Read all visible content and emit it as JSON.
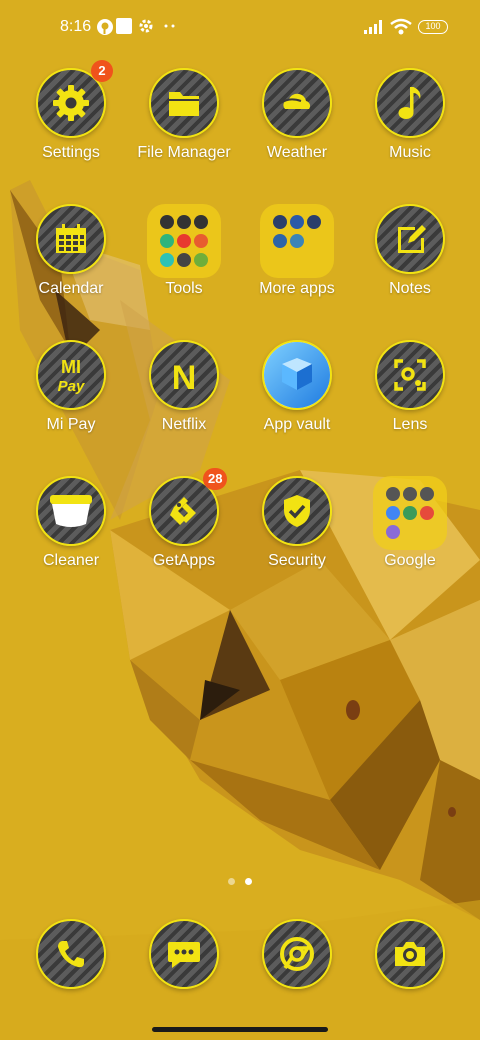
{
  "status_bar": {
    "time": "8:16",
    "battery": "100",
    "left_icons": [
      "pinterest-icon",
      "square-icon",
      "gear-icon",
      "more-dots-icon"
    ],
    "right_icons": [
      "signal-icon",
      "wifi-icon",
      "battery-icon"
    ]
  },
  "apps": [
    {
      "label": "Settings",
      "icon": "gear-icon"
    },
    {
      "label": "File Manager",
      "icon": "folder-icon"
    },
    {
      "label": "Weather",
      "icon": "weather-icon"
    },
    {
      "label": "Music",
      "icon": "music-note-icon"
    },
    {
      "label": "Calendar",
      "icon": "calendar-icon"
    },
    {
      "label": "Tools",
      "icon": "folder-grid-icon"
    },
    {
      "label": "More apps",
      "icon": "folder-grid-icon"
    },
    {
      "label": "Notes",
      "icon": "notes-icon"
    },
    {
      "label": "Mi Pay",
      "icon": "mi-pay-icon"
    },
    {
      "label": "Netflix",
      "icon": "netflix-icon"
    },
    {
      "label": "App vault",
      "icon": "app-vault-icon"
    },
    {
      "label": "Lens",
      "icon": "lens-icon"
    },
    {
      "label": "Cleaner",
      "icon": "cleaner-icon"
    },
    {
      "label": "GetApps",
      "icon": "getapps-icon"
    },
    {
      "label": "Security",
      "icon": "shield-icon"
    },
    {
      "label": "Google",
      "icon": "folder-grid-icon"
    }
  ],
  "badges": {
    "settings": "2",
    "getapps": "28"
  },
  "icon_glyphs": {
    "mi_pay_top": "MI",
    "mi_pay_bottom": "Pay",
    "netflix": "N"
  },
  "dock": [
    {
      "icon": "phone-icon"
    },
    {
      "icon": "messages-icon"
    },
    {
      "icon": "chrome-icon"
    },
    {
      "icon": "camera-icon"
    }
  ],
  "page_indicator": {
    "pages": 2,
    "current": 2
  },
  "colors": {
    "background": "#d9ae1f",
    "accent_yellow": "#f2e312",
    "badge": "#f0531c"
  }
}
